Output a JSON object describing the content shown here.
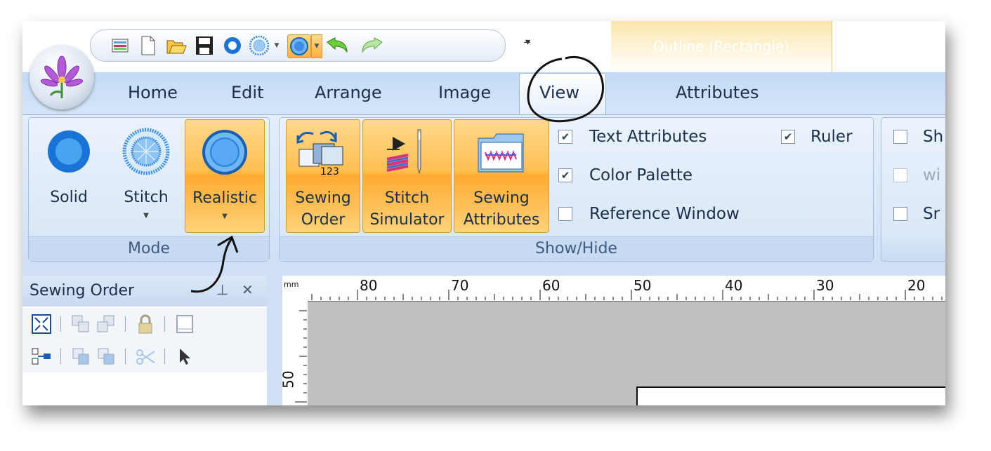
{
  "context_tab": {
    "label": "Outline (Rectangle)"
  },
  "tabs": [
    {
      "label": "Home"
    },
    {
      "label": "Edit"
    },
    {
      "label": "Arrange"
    },
    {
      "label": "Image"
    },
    {
      "label": "View",
      "active": true
    },
    {
      "label": "Attributes"
    }
  ],
  "qat_icons": [
    "design-center-icon",
    "new-icon",
    "open-icon",
    "save-icon",
    "solid-view-icon",
    "stitch-view-icon",
    "realistic-view-icon",
    "undo-icon",
    "redo-icon"
  ],
  "mode_group": {
    "label": "Mode",
    "solid": "Solid",
    "stitch": "Stitch",
    "realistic": "Realistic"
  },
  "showhide_group": {
    "label": "Show/Hide",
    "sewing_order": [
      "Sewing",
      "Order"
    ],
    "stitch_simulator": [
      "Stitch",
      "Simulator"
    ],
    "sewing_attributes": [
      "Sewing",
      "Attributes"
    ],
    "sewing_order_badge": "123",
    "checkboxes": {
      "text_attributes": {
        "label": "Text Attributes",
        "checked": true
      },
      "ruler": {
        "label": "Ruler",
        "checked": true
      },
      "color_palette": {
        "label": "Color Palette",
        "checked": true
      },
      "reference_window": {
        "label": "Reference Window",
        "checked": false
      }
    }
  },
  "partial_group": {
    "items": [
      {
        "label": "Sh",
        "checked": false,
        "enabled": true
      },
      {
        "label": "wi",
        "checked": false,
        "enabled": false
      },
      {
        "label": "Sr",
        "checked": false,
        "enabled": true
      }
    ]
  },
  "sewing_order_panel": {
    "title": "Sewing Order",
    "pin": "ᵖ",
    "close": "✕"
  },
  "ruler": {
    "unit": "mm",
    "ticks": [
      "80",
      "70",
      "60",
      "50",
      "40",
      "30",
      "20"
    ],
    "vertical_tick": "50"
  },
  "colors": {
    "ribbon_blue": "#cfe0f5",
    "selected_orange": "#ffbf53",
    "context_tab": "#fbe6ad",
    "canvas_gray": "#c0c0c0"
  }
}
